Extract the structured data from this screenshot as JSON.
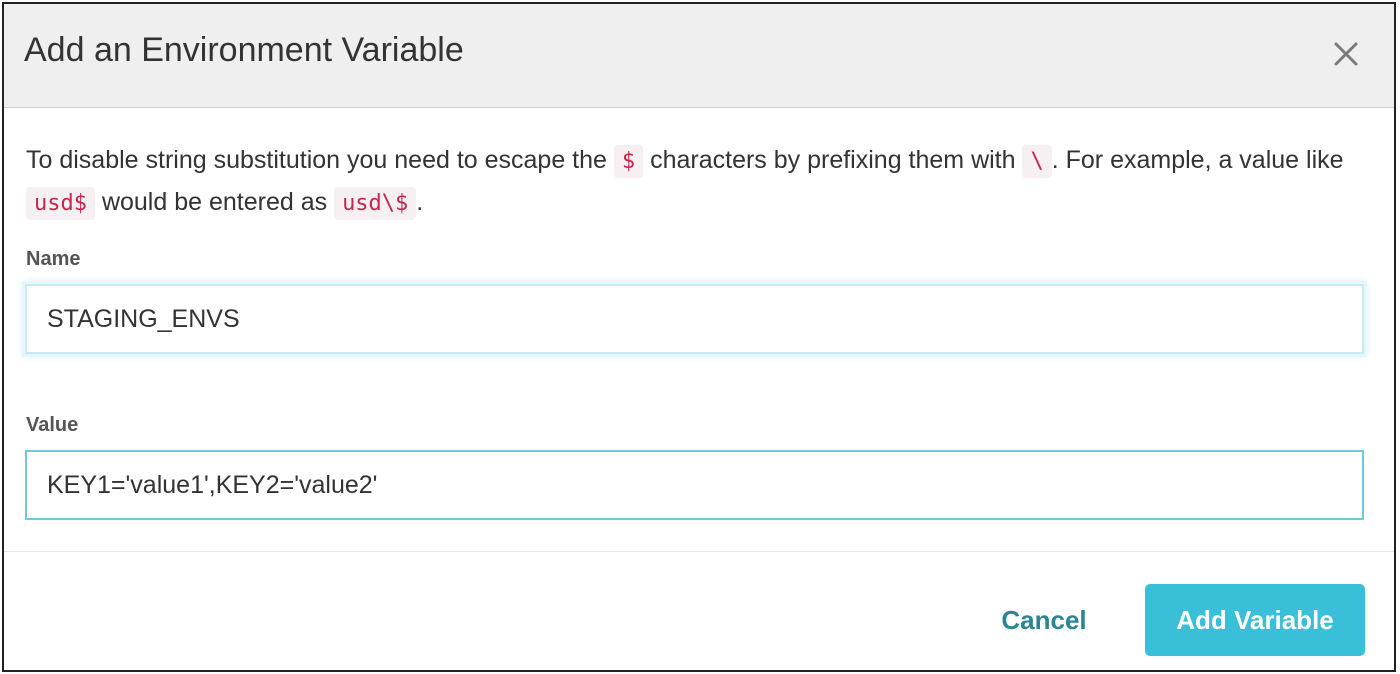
{
  "modal": {
    "title": "Add an Environment Variable",
    "close_icon": "close-icon",
    "description": {
      "text_1": "To disable string substitution you need to escape the",
      "code_1": "$",
      "text_2": "characters by prefixing them with",
      "code_2": "\\",
      "text_3": ". For example, a value like",
      "code_3": "usd$",
      "text_4": "would be entered as",
      "code_4": "usd\\$",
      "text_5": "."
    }
  },
  "form": {
    "name_label": "Name",
    "name_value": "STAGING_ENVS",
    "value_label": "Value",
    "value_value": "KEY1='value1',KEY2='value2'"
  },
  "actions": {
    "cancel_label": "Cancel",
    "add_label": "Add Variable"
  },
  "colors": {
    "accent": "#39c0d8",
    "link": "#2a8696",
    "code_text": "#c7254e"
  }
}
